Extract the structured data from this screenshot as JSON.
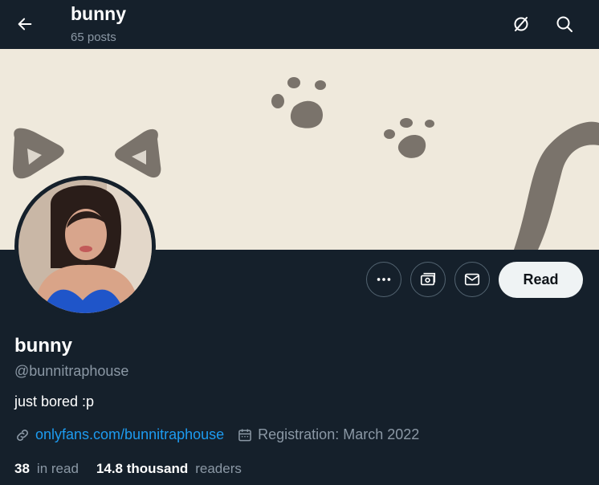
{
  "header": {
    "title": "bunny",
    "posts": "65 posts"
  },
  "icons": {
    "back": "arrow-left-icon",
    "top_left": "crossed-circle-icon",
    "top_right": "search-icon",
    "more": "more-icon",
    "subscribe": "money-icon",
    "message": "envelope-icon",
    "link": "link-icon",
    "calendar": "calendar-icon"
  },
  "actions": {
    "read_label": "Read"
  },
  "profile": {
    "name": "bunny",
    "handle": "@bunnitraphouse",
    "bio": "just bored :p",
    "link": "onlyfans.com/bunnitraphouse",
    "registration": "Registration: March 2022",
    "following_count": "38",
    "following_label": "in read",
    "followers_count": "14.8 thousand",
    "followers_label": "readers"
  },
  "colors": {
    "background": "#15202b",
    "accent": "#1d9bf0",
    "muted": "#8b98a5",
    "banner": "#efe9dc"
  }
}
